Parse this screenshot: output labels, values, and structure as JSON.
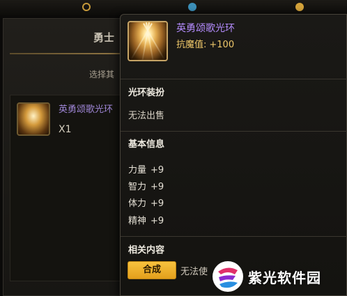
{
  "background": {
    "title": "勇士",
    "subtitle": "选择其",
    "item": {
      "name": "英勇颂歌光环",
      "count": "X1"
    }
  },
  "tooltip": {
    "item_name": "英勇颂歌光环",
    "stat_label": "抗魔值:",
    "stat_value": "+100",
    "sections": {
      "type_header": "光环装扮",
      "trade_note": "无法出售",
      "basic_header": "基本信息",
      "attributes": [
        {
          "name": "力量",
          "value": "+9"
        },
        {
          "name": "智力",
          "value": "+9"
        },
        {
          "name": "体力",
          "value": "+9"
        },
        {
          "name": "精神",
          "value": "+9"
        }
      ],
      "related_header": "相关内容",
      "compose_button": "合成",
      "compose_note": "无法使"
    },
    "colors": {
      "item_name": "#b58cff",
      "stat": "#f0c86a",
      "button": "#f8c23e"
    }
  },
  "watermark": {
    "text": "紫光软件园",
    "icon": "zg-logo-icon"
  }
}
